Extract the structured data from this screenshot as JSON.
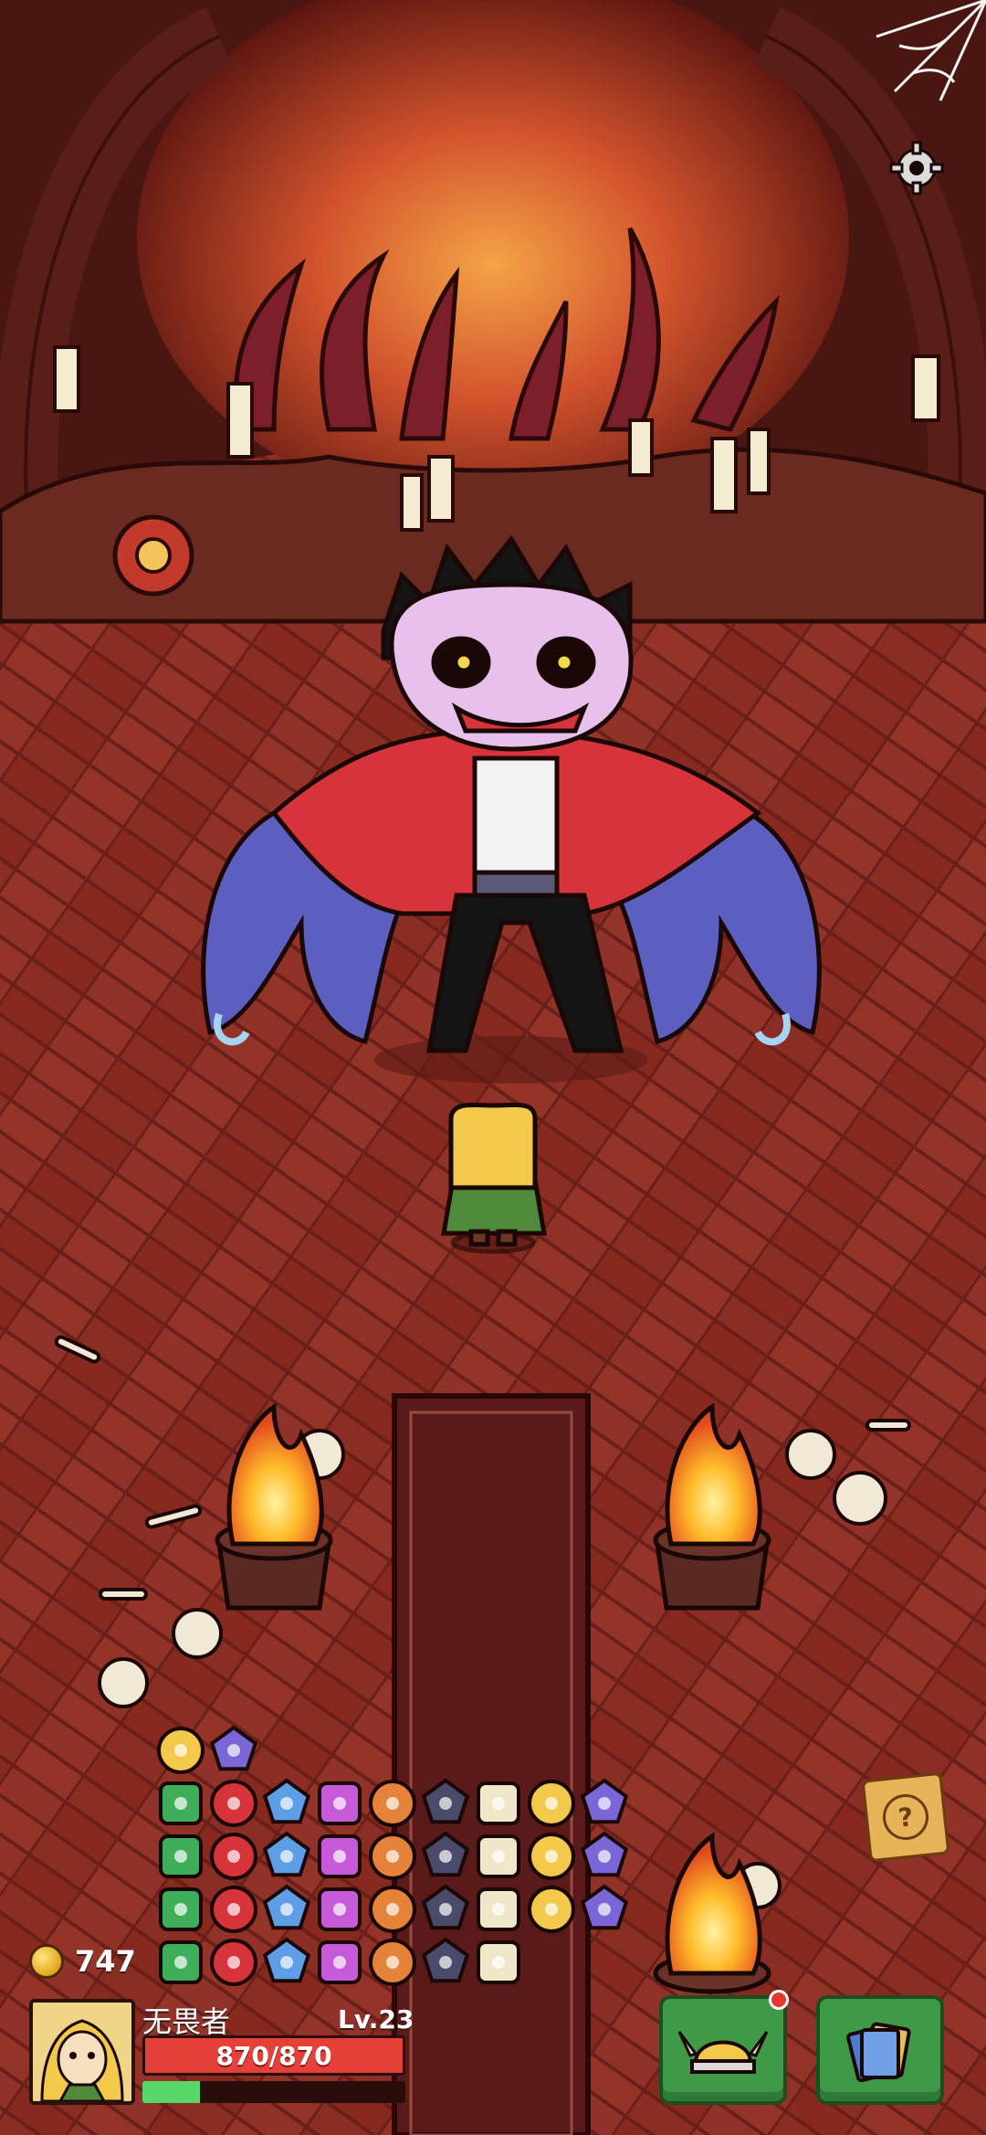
{
  "player": {
    "name": "无畏者",
    "level": "Lv.23",
    "hp_text": "870/870",
    "hp_fraction": 1.0,
    "xp_fraction": 0.22
  },
  "currency": {
    "coins": "747"
  },
  "buttons": {
    "hero_icon": "viking-helmet-icon",
    "cards_icon": "cards-icon",
    "help_icon": "question-card-icon",
    "settings_icon": "gear-icon"
  },
  "inventory": {
    "item_count": 36
  },
  "colors": {
    "floor": "#8f3127",
    "hp": "#e5403a",
    "xp": "#58d66a",
    "button": "#3f9a47"
  }
}
